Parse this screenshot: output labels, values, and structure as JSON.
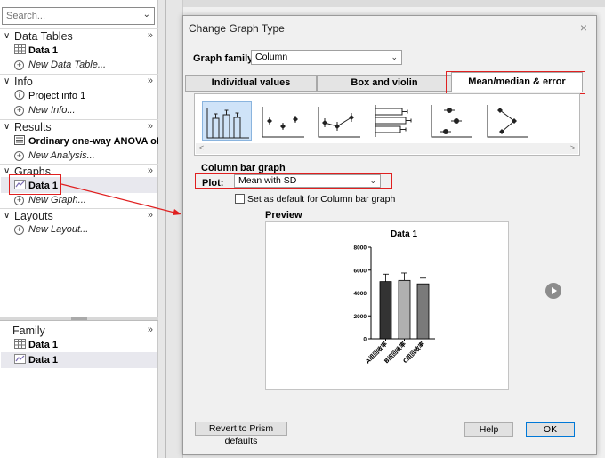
{
  "navigator": {
    "search_placeholder": "Search...",
    "sections": {
      "data_tables": {
        "title": "Data Tables",
        "items": [
          "Data 1"
        ],
        "add": "New Data Table..."
      },
      "info": {
        "title": "Info",
        "items": [
          "Project info 1"
        ],
        "add": "New Info..."
      },
      "results": {
        "title": "Results",
        "items": [
          "Ordinary one-way ANOVA of..."
        ],
        "add": "New Analysis..."
      },
      "graphs": {
        "title": "Graphs",
        "items": [
          "Data 1"
        ],
        "add": "New Graph..."
      },
      "layouts": {
        "title": "Layouts",
        "add": "New Layout..."
      }
    },
    "more_glyph": "»",
    "family": {
      "title": "Family",
      "items": [
        "Data 1",
        "Data 1"
      ]
    }
  },
  "dialog": {
    "title": "Change Graph Type",
    "close": "×",
    "graph_family_label": "Graph family:",
    "graph_family_value": "Column",
    "tabs": [
      "Individual values",
      "Box and violin",
      "Mean/median & error"
    ],
    "active_tab": "Mean/median & error",
    "section_title": "Column bar graph",
    "plot_label": "Plot:",
    "plot_value": "Mean with SD",
    "default_checkbox_label": "Set as default for Column bar graph",
    "preview_label": "Preview",
    "buttons": {
      "revert": "Revert to Prism defaults",
      "help": "Help",
      "ok": "OK"
    }
  },
  "colors": {
    "highlight_red": "#e02020",
    "selected_thumb": "#cfe3f8",
    "ok_border": "#0078d7"
  },
  "chart_data": {
    "type": "bar",
    "title": "Data 1",
    "categories": [
      "A组回收率",
      "B组回收率",
      "C组回收率"
    ],
    "values": [
      5000,
      5100,
      4800
    ],
    "errors": [
      650,
      650,
      500
    ],
    "colors": [
      "#333333",
      "#b0b0b0",
      "#7a7a7a"
    ],
    "ylim": [
      0,
      8000
    ],
    "yticks": [
      "0",
      "2000",
      "4000",
      "6000",
      "8000"
    ]
  }
}
